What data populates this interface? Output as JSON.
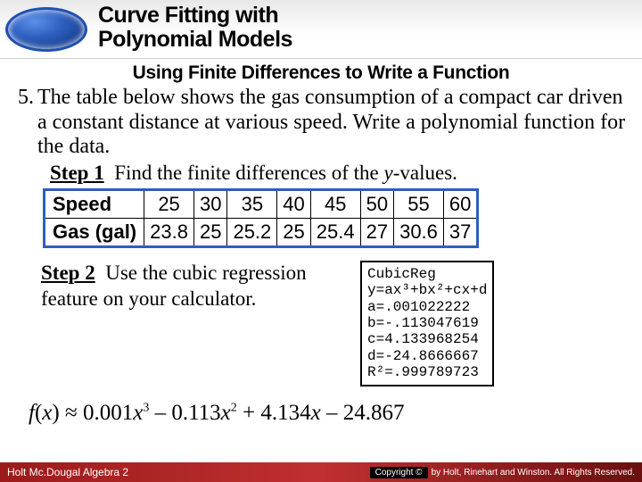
{
  "header": {
    "title_line1": "Curve Fitting with",
    "title_line2": "Polynomial Models"
  },
  "subtitle": "Using Finite Differences to Write a Function",
  "problem": {
    "number": "5.",
    "text": "The table below shows the gas consumption of a compact car driven a constant distance at various speed. Write a polynomial function for the data."
  },
  "step1": {
    "label": "Step 1",
    "text_pre": "Find the finite differences of the ",
    "text_it": "y",
    "text_post": "-values."
  },
  "table": {
    "row1_head": "Speed",
    "row2_head": "Gas (gal)",
    "cols": [
      "25",
      "30",
      "35",
      "40",
      "45",
      "50",
      "55",
      "60"
    ],
    "vals": [
      "23.8",
      "25",
      "25.2",
      "25",
      "25.4",
      "27",
      "30.6",
      "37"
    ]
  },
  "step2": {
    "label": "Step 2",
    "text": "Use the cubic regression feature on your calculator."
  },
  "calc": {
    "l1": "CubicReg",
    "l2": "y=ax³+bx²+cx+d",
    "l3": "a=.001022222",
    "l4": "b=-.113047619",
    "l5": "c=4.133968254",
    "l6": "d=-24.8666667",
    "l7": "R²=.999789723"
  },
  "func": {
    "lhs": "f(x)",
    "approx": " ≈ ",
    "expr": "0.001x³ – 0.113x² + 4.134x – 24.867"
  },
  "footer": {
    "left": "Holt Mc.Dougal Algebra 2",
    "copy": "Copyright ©",
    "right": "by Holt, Rinehart and Winston. All Rights Reserved."
  },
  "chart_data": {
    "type": "table",
    "title": "Gas consumption vs speed",
    "columns": [
      "Speed",
      "Gas (gal)"
    ],
    "rows": [
      [
        25,
        23.8
      ],
      [
        30,
        25
      ],
      [
        35,
        25.2
      ],
      [
        40,
        25
      ],
      [
        45,
        25.4
      ],
      [
        50,
        27
      ],
      [
        55,
        30.6
      ],
      [
        60,
        37
      ]
    ],
    "regression": {
      "model": "cubic",
      "a": 0.001022222,
      "b": -0.113047619,
      "c": 4.133968254,
      "d": -24.8666667,
      "r_squared": 0.999789723
    }
  }
}
